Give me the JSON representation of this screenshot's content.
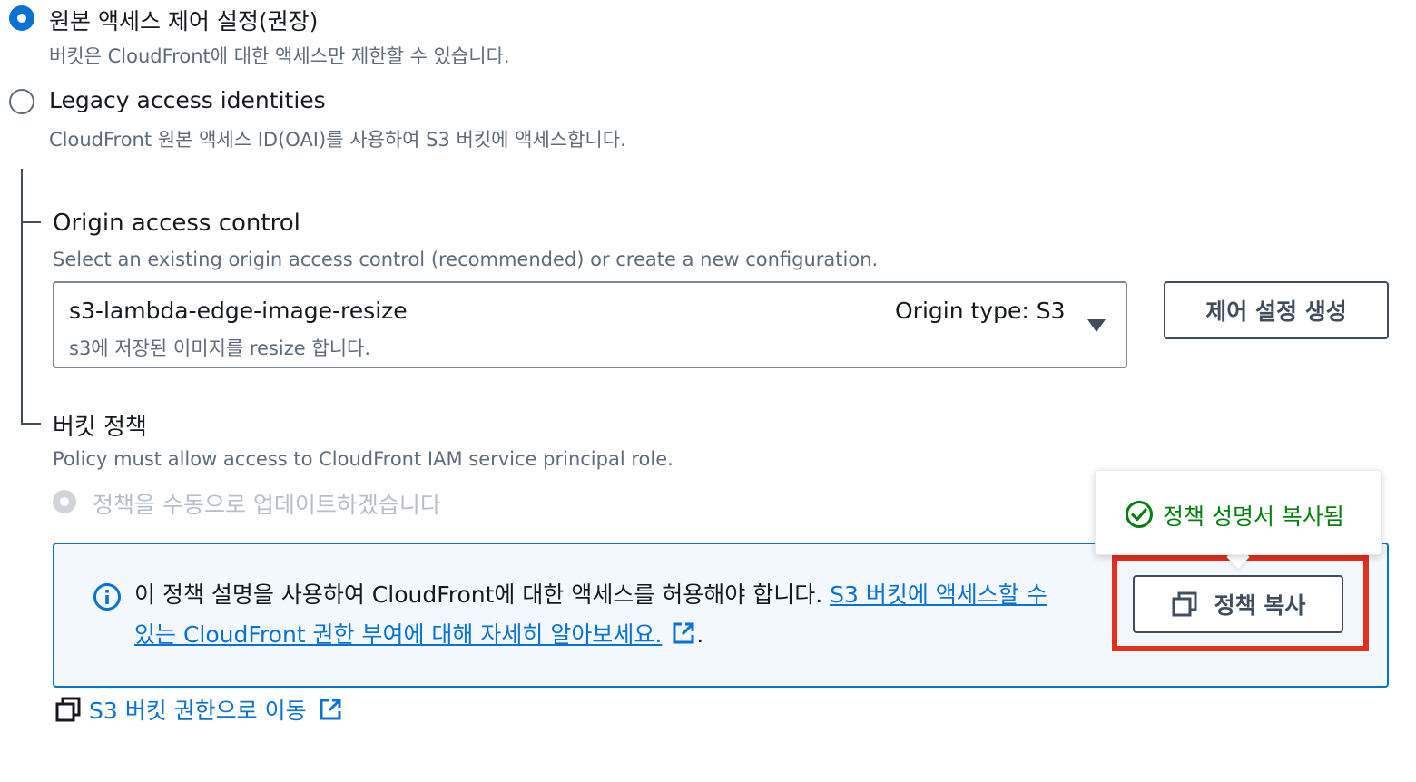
{
  "origin_access": {
    "options": [
      {
        "label": "원본 액세스 제어 설정(권장)",
        "description": "버킷은 CloudFront에 대한 액세스만 제한할 수 있습니다.",
        "checked": true
      },
      {
        "label": "Legacy access identities",
        "description": "CloudFront 원본 액세스 ID(OAI)를 사용하여 S3 버킷에 액세스합니다.",
        "checked": false
      }
    ]
  },
  "oac": {
    "title": "Origin access control",
    "description": "Select an existing origin access control (recommended) or create a new configuration.",
    "select": {
      "value": "s3-lambda-edge-image-resize",
      "description": "s3에 저장된 이미지를 resize 합니다.",
      "tag": "Origin type: S3"
    },
    "create_button": "제어 설정 생성"
  },
  "bucket_policy": {
    "title": "버킷 정책",
    "description": "Policy must allow access to CloudFront IAM service principal role.",
    "manual_option": "정책을 수동으로 업데이트하겠습니다",
    "alert": {
      "text_before": "이 정책 설명을 사용하여 CloudFront에 대한 액세스를 허용해야 합니다. ",
      "link_line1": "S3 버킷에 액세스할 수",
      "link_line2": "있는 CloudFront 권한 부여에 대해 자세히 알아보세요.",
      "text_after": "."
    },
    "copy_button": "정책 복사",
    "popover_text": "정책 성명서 복사됨",
    "go_to_permissions_link": "S3 버킷 권한으로 이동"
  },
  "colors": {
    "primary_blue": "#0972d3",
    "success_green": "#037f0c",
    "highlight_red": "#e2311d",
    "alert_bg": "#f2f8fd"
  },
  "icons": [
    "info-icon",
    "copy-icon",
    "external-link-icon",
    "success-check-icon",
    "caret-down-icon"
  ]
}
